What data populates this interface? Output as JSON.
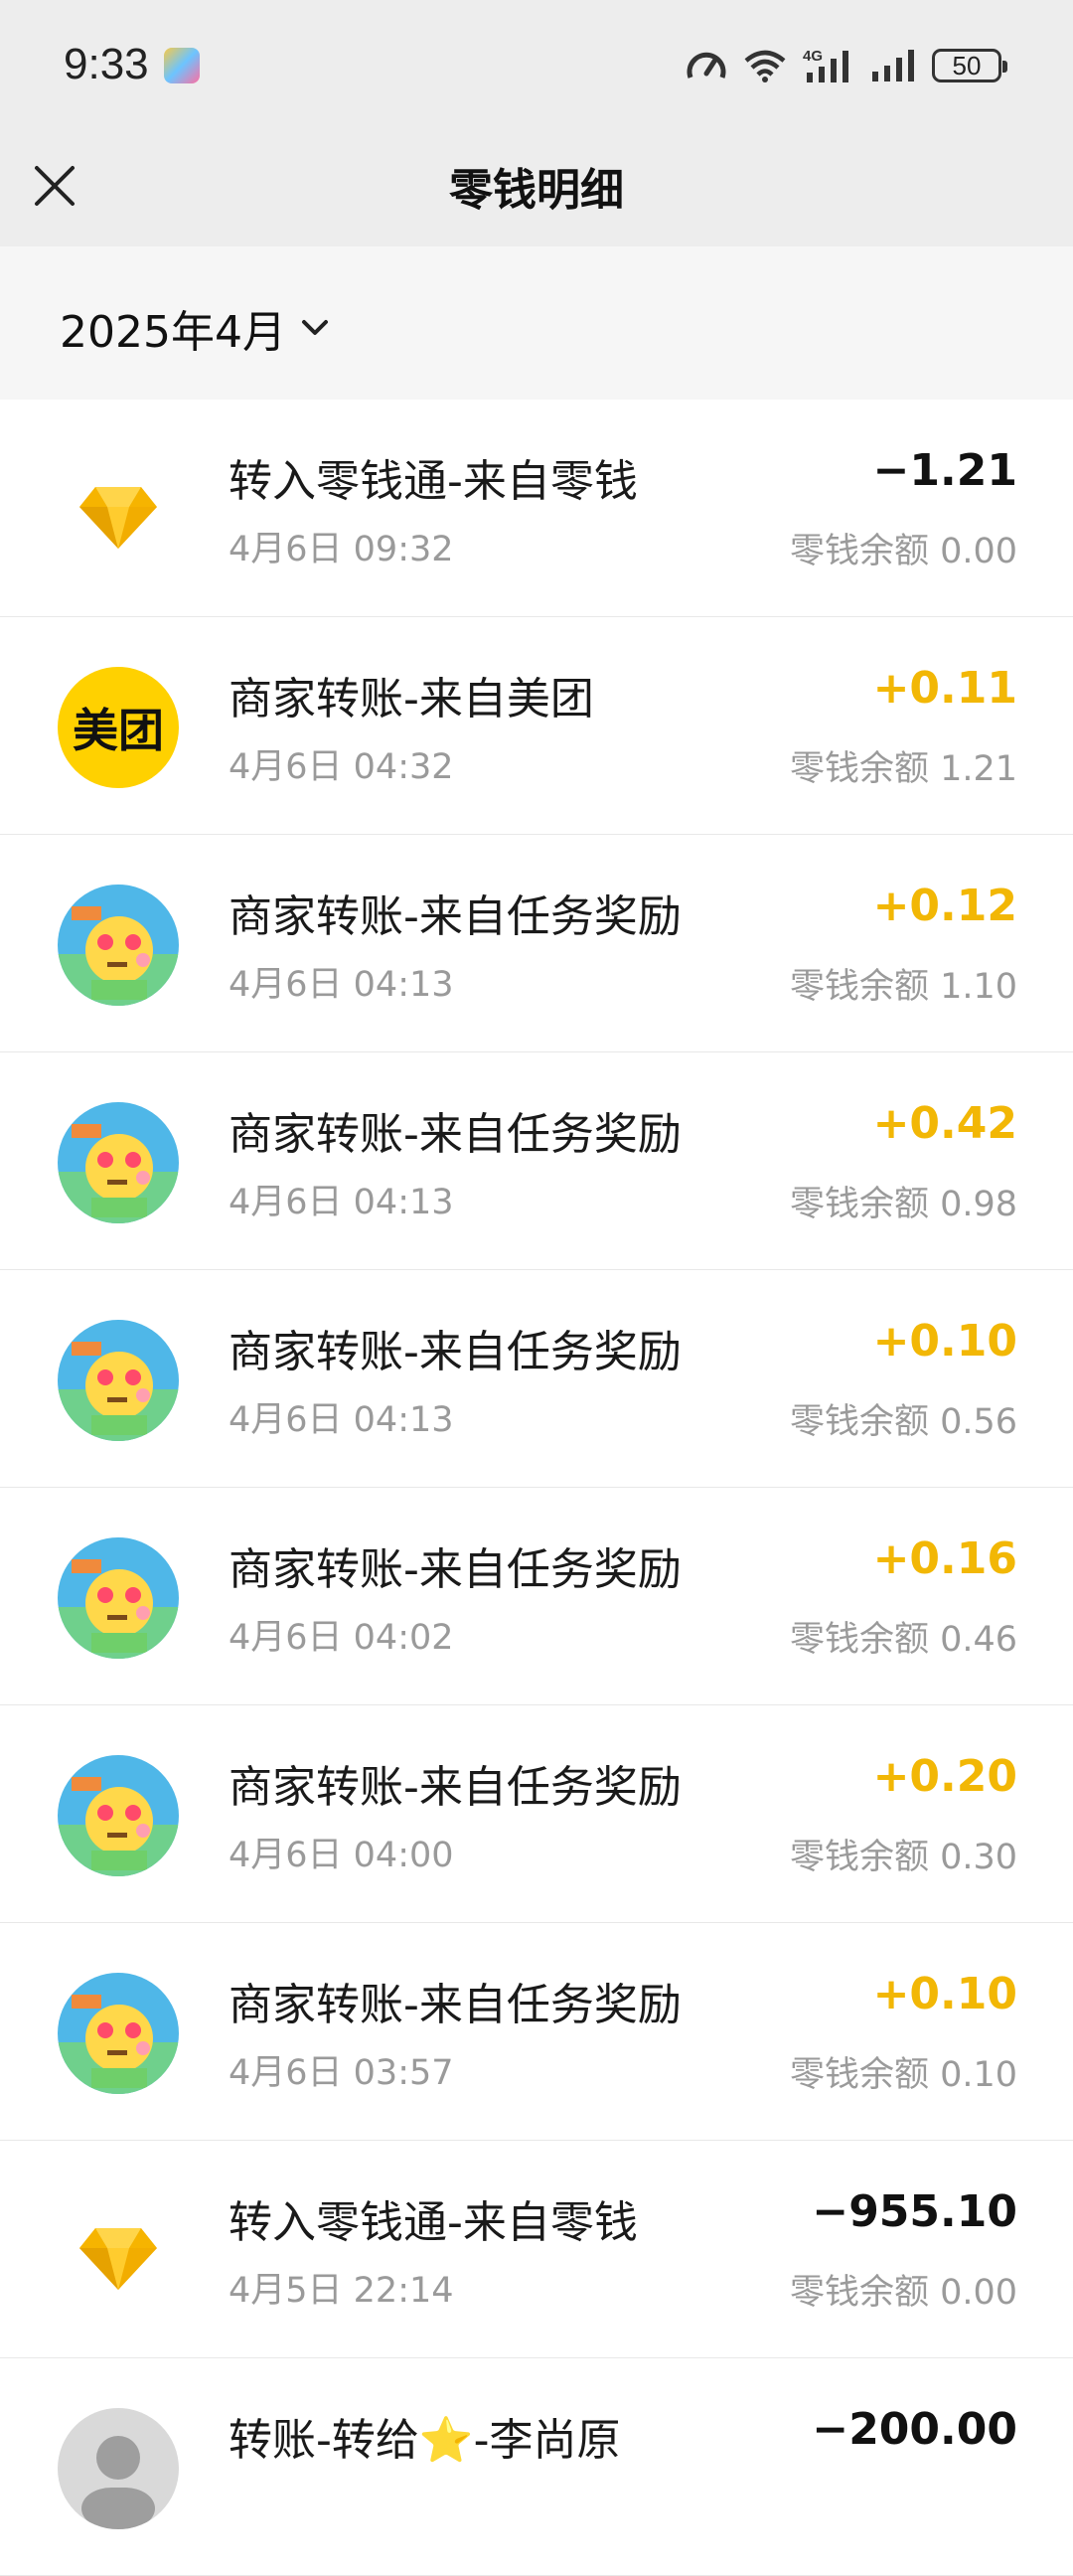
{
  "status_bar": {
    "time": "9:33",
    "battery": "50",
    "icons": [
      "speed-icon",
      "wifi-icon",
      "4g-signal-icon",
      "signal-icon",
      "battery-icon"
    ]
  },
  "header": {
    "title": "零钱明细",
    "close_icon": "close-icon"
  },
  "filter": {
    "month": "2025年4月",
    "dropdown_icon": "chevron-down-icon"
  },
  "colors": {
    "positive": "#f2b705",
    "negative": "#111111",
    "meituan": "#ffd100"
  },
  "transactions": [
    {
      "title": "转入零钱通-来自零钱",
      "time": "4月6日 09:32",
      "amount": "−1.21",
      "balance": "零钱余额 0.00",
      "avatar": "diamond-icon"
    },
    {
      "title": "商家转账-来自美团",
      "time": "4月6日 04:32",
      "amount": "+0.11",
      "balance": "零钱余额 1.21",
      "avatar": "meituan-logo",
      "avatar_text": "美团"
    },
    {
      "title": "商家转账-来自任务奖励",
      "time": "4月6日 04:13",
      "amount": "+0.12",
      "balance": "零钱余额 1.10",
      "avatar": "mascot-avatar"
    },
    {
      "title": "商家转账-来自任务奖励",
      "time": "4月6日 04:13",
      "amount": "+0.42",
      "balance": "零钱余额 0.98",
      "avatar": "mascot-avatar"
    },
    {
      "title": "商家转账-来自任务奖励",
      "time": "4月6日 04:13",
      "amount": "+0.10",
      "balance": "零钱余额 0.56",
      "avatar": "mascot-avatar"
    },
    {
      "title": "商家转账-来自任务奖励",
      "time": "4月6日 04:02",
      "amount": "+0.16",
      "balance": "零钱余额 0.46",
      "avatar": "mascot-avatar"
    },
    {
      "title": "商家转账-来自任务奖励",
      "time": "4月6日 04:00",
      "amount": "+0.20",
      "balance": "零钱余额 0.30",
      "avatar": "mascot-avatar"
    },
    {
      "title": "商家转账-来自任务奖励",
      "time": "4月6日 03:57",
      "amount": "+0.10",
      "balance": "零钱余额 0.10",
      "avatar": "mascot-avatar"
    },
    {
      "title": "转入零钱通-来自零钱",
      "time": "4月5日 22:14",
      "amount": "−955.10",
      "balance": "零钱余额 0.00",
      "avatar": "diamond-icon"
    },
    {
      "title": "转账-转给⭐-李尚原",
      "time": "",
      "amount": "−200.00",
      "balance": "",
      "avatar": "user-avatar"
    }
  ]
}
